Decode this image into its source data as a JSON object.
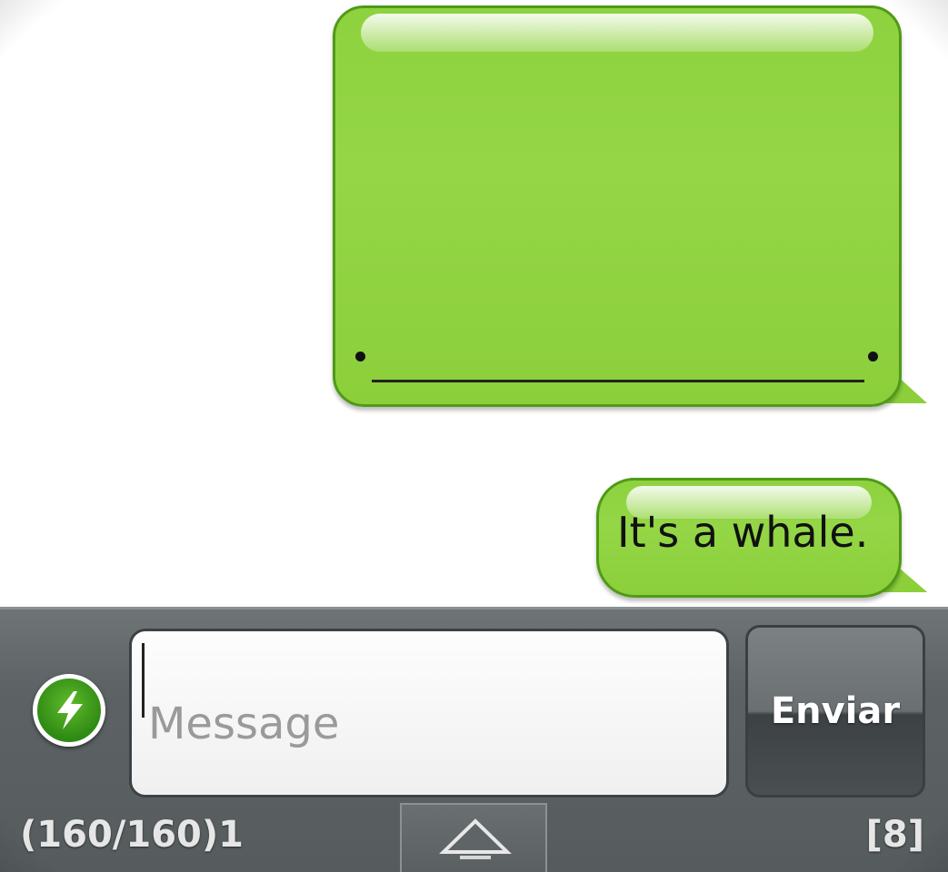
{
  "conversation": {
    "messages": [
      {
        "type": "drawing",
        "sender": "me"
      },
      {
        "type": "text",
        "sender": "me",
        "text": "It's a whale."
      }
    ]
  },
  "composer": {
    "placeholder": "Message",
    "send_label": "Enviar",
    "char_counter": "(160/160)1",
    "message_count": "[8]"
  },
  "icons": {
    "attach": "lightning-bolt-icon",
    "expand": "triangle-up-icon"
  },
  "colors": {
    "bubble_green": "#8ed23f",
    "bubble_border": "#4f9a17",
    "toolbar_gray": "#5d6365",
    "send_text": "#ffffff"
  }
}
